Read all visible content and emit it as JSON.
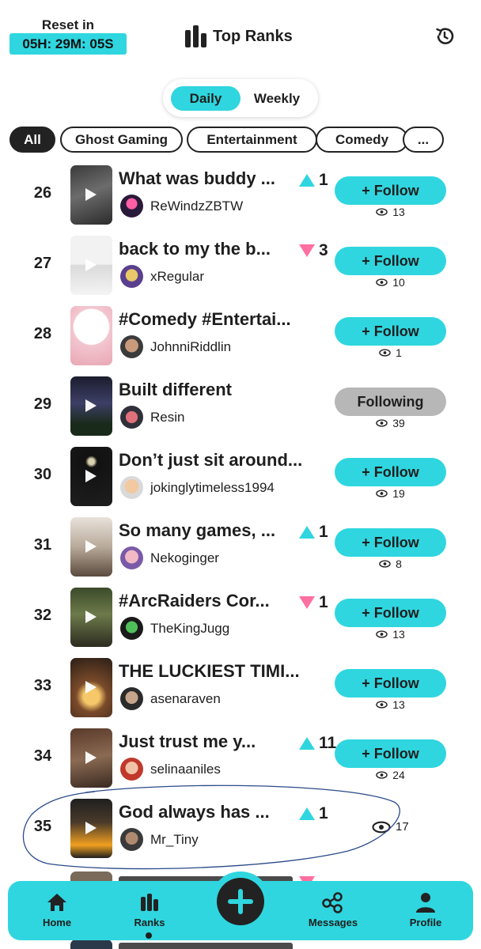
{
  "header": {
    "reset_label": "Reset in",
    "reset_timer": "05H: 29M: 05S",
    "title": "Top Ranks",
    "title_icon": "bar-chart-icon",
    "history_icon": "history-icon"
  },
  "toggle": {
    "daily": "Daily",
    "weekly": "Weekly",
    "selected": "Daily"
  },
  "chips": [
    "All",
    "Ghost Gaming",
    "Entertainment",
    "Comedy",
    "..."
  ],
  "chips_selected": "All",
  "colors": {
    "accent": "#2fd6df",
    "down": "#ff6fa0",
    "following": "#b7b7b7",
    "dark": "#222222"
  },
  "rows": [
    {
      "rank": "26",
      "title": "What was buddy ...",
      "delta_dir": "up",
      "delta": "1",
      "user": "ReWindzZBTW",
      "button": "+ Follow",
      "views": "13"
    },
    {
      "rank": "27",
      "title": "back to my the b...",
      "delta_dir": "down",
      "delta": "3",
      "user": "xRegular",
      "button": "+ Follow",
      "views": "10"
    },
    {
      "rank": "28",
      "title": "#Comedy #Entertai...",
      "delta_dir": "",
      "delta": "",
      "user": "JohnniRiddlin",
      "button": "+ Follow",
      "views": "1"
    },
    {
      "rank": "29",
      "title": "Built different",
      "delta_dir": "",
      "delta": "",
      "user": "Resin",
      "button": "Following",
      "views": "39"
    },
    {
      "rank": "30",
      "title": "Don’t just sit around...",
      "delta_dir": "",
      "delta": "",
      "user": "jokinglytimeless1994",
      "button": "+ Follow",
      "views": "19"
    },
    {
      "rank": "31",
      "title": "So many games, ...",
      "delta_dir": "up",
      "delta": "1",
      "user": "Nekoginger",
      "button": "+ Follow",
      "views": "8"
    },
    {
      "rank": "32",
      "title": "#ArcRaiders Cor...",
      "delta_dir": "down",
      "delta": "1",
      "user": "TheKingJugg",
      "button": "+ Follow",
      "views": "13"
    },
    {
      "rank": "33",
      "title": "THE LUCKIEST TIMI...",
      "delta_dir": "",
      "delta": "",
      "user": "asenaraven",
      "button": "+ Follow",
      "views": "13"
    },
    {
      "rank": "34",
      "title": "Just trust me y...",
      "delta_dir": "up",
      "delta": "11",
      "user": "selinaaniles",
      "button": "+ Follow",
      "views": "24"
    },
    {
      "rank": "35",
      "title": "God always has ...",
      "delta_dir": "up",
      "delta": "1",
      "user": "Mr_Tiny",
      "button": "",
      "views": "17"
    }
  ],
  "nav": {
    "home": "Home",
    "ranks": "Ranks",
    "create": "create-plus-icon",
    "messages": "Messages",
    "profile": "Profile",
    "active": "Ranks"
  }
}
